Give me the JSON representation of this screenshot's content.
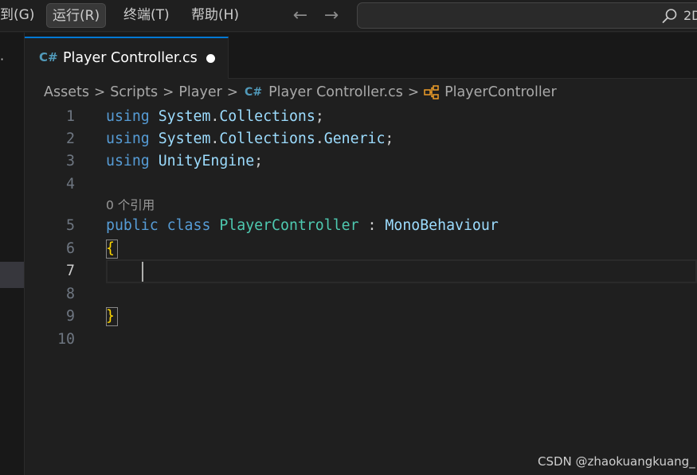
{
  "menu": {
    "items": [
      {
        "label": "到(G)",
        "active": false
      },
      {
        "label": "运行(R)",
        "active": true
      },
      {
        "label": "终端(T)",
        "active": false
      },
      {
        "label": "帮助(H)",
        "active": false
      }
    ],
    "back_glyph": "←",
    "forward_glyph": "→"
  },
  "search": {
    "text": "2D",
    "icon": "search-icon"
  },
  "strip": {
    "glyph": "·"
  },
  "tab": {
    "icon_text": "C#",
    "label": "Player Controller.cs",
    "modified": true,
    "accent": "#0078d4"
  },
  "breadcrumb": {
    "parts": [
      "Assets",
      "Scripts",
      "Player"
    ],
    "file_icon": "C#",
    "file": "Player Controller.cs",
    "class_icon": "class-icon",
    "symbol": "PlayerController",
    "separator": ">"
  },
  "editor": {
    "codelens": "0 个引用",
    "current_line": 7,
    "lines": [
      {
        "num": "1",
        "tokens": [
          {
            "t": "using",
            "c": "kw"
          },
          {
            "t": " ",
            "c": "plain"
          },
          {
            "t": "System",
            "c": "ns"
          },
          {
            "t": ".",
            "c": "plain"
          },
          {
            "t": "Collections",
            "c": "ns"
          },
          {
            "t": ";",
            "c": "plain"
          }
        ]
      },
      {
        "num": "2",
        "tokens": [
          {
            "t": "using",
            "c": "kw"
          },
          {
            "t": " ",
            "c": "plain"
          },
          {
            "t": "System",
            "c": "ns"
          },
          {
            "t": ".",
            "c": "plain"
          },
          {
            "t": "Collections",
            "c": "ns"
          },
          {
            "t": ".",
            "c": "plain"
          },
          {
            "t": "Generic",
            "c": "ns"
          },
          {
            "t": ";",
            "c": "plain"
          }
        ]
      },
      {
        "num": "3",
        "tokens": [
          {
            "t": "using",
            "c": "kw"
          },
          {
            "t": " ",
            "c": "plain"
          },
          {
            "t": "UnityEngine",
            "c": "ns"
          },
          {
            "t": ";",
            "c": "plain"
          }
        ]
      },
      {
        "num": "4",
        "tokens": []
      },
      {
        "num": "5",
        "tokens": [
          {
            "t": "public",
            "c": "kw"
          },
          {
            "t": " ",
            "c": "plain"
          },
          {
            "t": "class",
            "c": "kw"
          },
          {
            "t": " ",
            "c": "plain"
          },
          {
            "t": "PlayerController",
            "c": "cls"
          },
          {
            "t": " : ",
            "c": "plain"
          },
          {
            "t": "MonoBehaviour",
            "c": "ns"
          }
        ]
      },
      {
        "num": "6",
        "tokens": [
          {
            "t": "{",
            "c": "brace"
          }
        ]
      },
      {
        "num": "7",
        "tokens": []
      },
      {
        "num": "8",
        "tokens": []
      },
      {
        "num": "9",
        "tokens": [
          {
            "t": "}",
            "c": "brace"
          }
        ]
      },
      {
        "num": "10",
        "tokens": []
      }
    ]
  },
  "watermark": "CSDN @zhaokuangkuang_",
  "colors": {
    "keyword": "#569cd6",
    "namespace": "#9cdcfe",
    "class": "#4ec9b0",
    "brace": "#ffd700",
    "background": "#1f1f1f"
  }
}
